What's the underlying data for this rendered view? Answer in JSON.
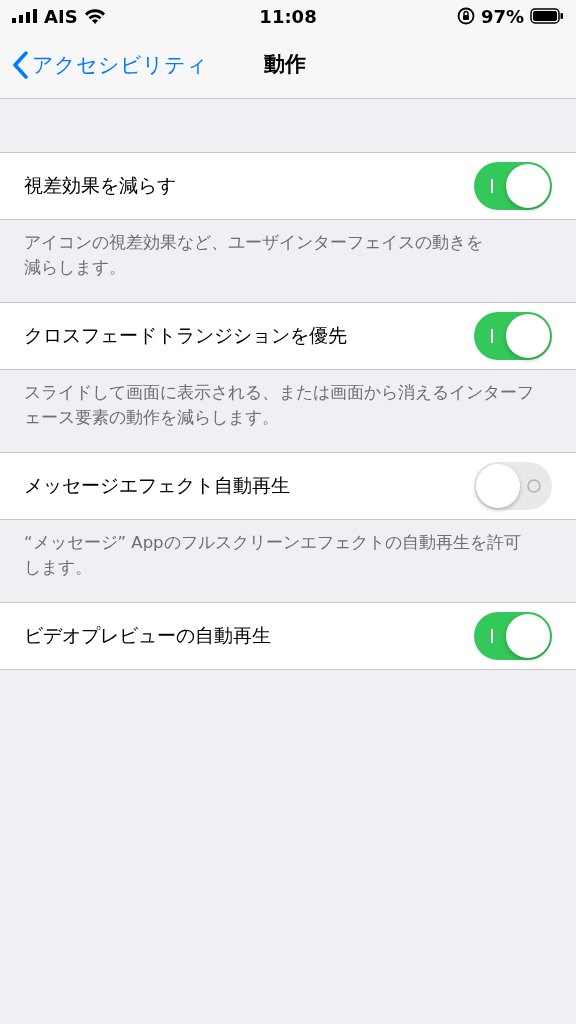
{
  "status_bar": {
    "carrier": "AIS",
    "time": "11:08",
    "battery": "97%"
  },
  "nav": {
    "back": "アクセシビリティ",
    "title": "動作"
  },
  "sections": [
    {
      "label": "視差効果を減らす",
      "on": true,
      "footer": [
        "アイコンの視差効果など、ユーザインターフェイスの動きを",
        "減らします。"
      ]
    },
    {
      "label": "クロスフェードトランジションを優先",
      "on": true,
      "footer": [
        "スライドして画面に表示される、または画面から消えるインターフ",
        "ェース要素の動作を減らします。"
      ]
    },
    {
      "label": "メッセージエフェクト自動再生",
      "on": false,
      "footer": [
        "“メッセージ” Appのフルスクリーンエフェクトの自動再生を許可",
        "します。"
      ]
    },
    {
      "label": "ビデオプレビューの自動再生",
      "on": true
    }
  ]
}
